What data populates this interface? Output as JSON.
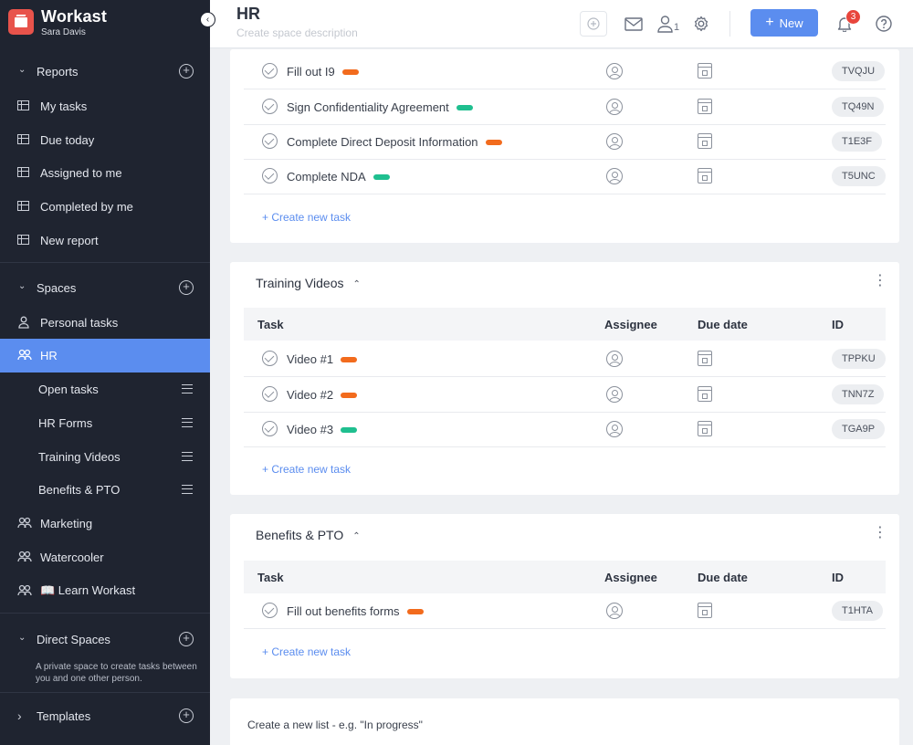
{
  "app": {
    "name": "Workast",
    "user": "Sara Davis"
  },
  "sidebar": {
    "reports": {
      "label": "Reports",
      "items": [
        {
          "label": "My tasks"
        },
        {
          "label": "Due today"
        },
        {
          "label": "Assigned to me"
        },
        {
          "label": "Completed by me"
        },
        {
          "label": "New report"
        }
      ]
    },
    "spaces": {
      "label": "Spaces",
      "items": [
        {
          "label": "Personal tasks"
        },
        {
          "label": "HR"
        },
        {
          "label": "Open tasks"
        },
        {
          "label": "HR Forms"
        },
        {
          "label": "Training Videos"
        },
        {
          "label": "Benefits & PTO"
        },
        {
          "label": "Marketing"
        },
        {
          "label": "Watercooler"
        },
        {
          "label": "📖 Learn Workast"
        }
      ]
    },
    "direct": {
      "label": "Direct Spaces",
      "description": "A private space to create tasks between you and one other person."
    },
    "templates": {
      "label": "Templates"
    }
  },
  "header": {
    "title": "HR",
    "description_placeholder": "Create space description",
    "members_count": "1",
    "new_label": "New",
    "notifications_count": "3"
  },
  "columns": {
    "task": "Task",
    "assignee": "Assignee",
    "due": "Due date",
    "id": "ID"
  },
  "create_task_label": "+ Create new task",
  "lists": [
    {
      "title": "",
      "tasks": [
        {
          "name": "Fill out I9",
          "tag": "orange",
          "id": "TVQJU"
        },
        {
          "name": "Sign Confidentiality Agreement",
          "tag": "green",
          "id": "TQ49N"
        },
        {
          "name": "Complete Direct Deposit Information",
          "tag": "orange",
          "id": "T1E3F"
        },
        {
          "name": "Complete NDA",
          "tag": "green",
          "id": "T5UNC"
        }
      ]
    },
    {
      "title": "Training Videos",
      "tasks": [
        {
          "name": "Video #1",
          "tag": "orange",
          "id": "TPPKU"
        },
        {
          "name": "Video #2",
          "tag": "orange",
          "id": "TNN7Z"
        },
        {
          "name": "Video #3",
          "tag": "green",
          "id": "TGA9P"
        }
      ]
    },
    {
      "title": "Benefits & PTO",
      "tasks": [
        {
          "name": "Fill out benefits forms",
          "tag": "orange",
          "id": "T1HTA"
        }
      ]
    }
  ],
  "new_list_placeholder": "Create a new list - e.g. \"In progress\"",
  "colors": {
    "accent": "#5b8def",
    "sidebar_bg": "#1f2430",
    "tag_orange": "#f26b1d",
    "tag_green": "#1fbf8f",
    "badge": "#e8453c"
  },
  "icons": {
    "reports_item": "table-icon",
    "collapse": "chevron-left-icon",
    "members": "user-icon",
    "settings": "gear-icon",
    "mail": "mail-icon",
    "notifications": "bell-icon",
    "help": "help-icon"
  }
}
